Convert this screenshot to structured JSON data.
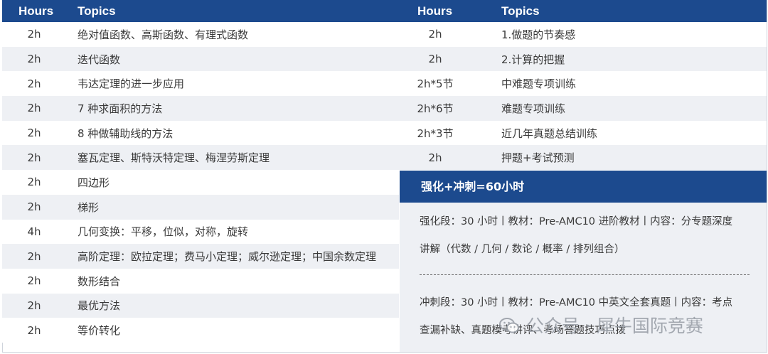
{
  "header": {
    "hours": "Hours",
    "topics": "Topics"
  },
  "left_rows": [
    {
      "hours": "2h",
      "topic": "绝对值函数、高斯函数、有理式函数"
    },
    {
      "hours": "2h",
      "topic": "迭代函数"
    },
    {
      "hours": "2h",
      "topic": "韦达定理的进一步应用"
    },
    {
      "hours": "2h",
      "topic": "7 种求面积的方法"
    },
    {
      "hours": "2h",
      "topic": "8 种做辅助线的方法"
    },
    {
      "hours": "2h",
      "topic": "塞瓦定理、斯特沃特定理、梅涅劳斯定理"
    },
    {
      "hours": "2h",
      "topic": "四边形"
    },
    {
      "hours": "2h",
      "topic": "梯形"
    },
    {
      "hours": "4h",
      "topic": "几何变换：平移，位似，对称，旋转"
    },
    {
      "hours": "2h",
      "topic": "高阶定理：欧拉定理；费马小定理；威尔逊定理；中国余数定理"
    },
    {
      "hours": "2h",
      "topic": "数形结合"
    },
    {
      "hours": "2h",
      "topic": "最优方法"
    },
    {
      "hours": "2h",
      "topic": "等价转化"
    }
  ],
  "right_rows": [
    {
      "hours": "2h",
      "topic": "1.做题的节奏感"
    },
    {
      "hours": "2h",
      "topic": "2.计算的把握"
    },
    {
      "hours": "2h*5节",
      "topic": "中难题专项训练"
    },
    {
      "hours": "2h*6节",
      "topic": "难题专项训练"
    },
    {
      "hours": "2h*3节",
      "topic": "近几年真题总结训练"
    },
    {
      "hours": "2h",
      "topic": "押题+考试预测"
    }
  ],
  "promo": {
    "title": "强化+冲刺=60小时",
    "line1": "强化段：30 小时丨教材：Pre-AMC10 进阶教材丨内容：分专题深度",
    "line2": "讲解（代数 / 几何 / 数论 / 概率 / 排列组合）",
    "line3": "冲刺段：30 小时丨教材：Pre-AMC10 中英文全套真题丨内容：考点",
    "line4": "查漏补缺、真题模考讲评、考场答题技巧点拨"
  },
  "watermark": {
    "text": "公众号 · 犀牛国际竞赛",
    "icon": "wechat-icon"
  },
  "colors": {
    "header": "#1c4a8e",
    "row_alt": "#eef0f4",
    "text": "#3a3a3a"
  }
}
